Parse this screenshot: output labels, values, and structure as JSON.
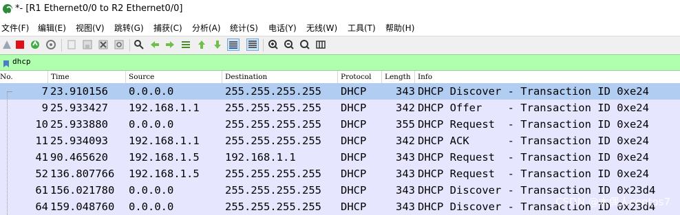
{
  "window": {
    "title": "*- [R1 Ethernet0/0 to R2 Ethernet0/0]"
  },
  "menu": [
    {
      "label": "文件(F)"
    },
    {
      "label": "编辑(E)"
    },
    {
      "label": "视图(V)"
    },
    {
      "label": "跳转(G)"
    },
    {
      "label": "捕获(C)"
    },
    {
      "label": "分析(A)"
    },
    {
      "label": "统计(S)"
    },
    {
      "label": "电话(Y)"
    },
    {
      "label": "无线(W)"
    },
    {
      "label": "工具(T)"
    },
    {
      "label": "帮助(H)"
    }
  ],
  "toolbar": {
    "icons": [
      "shark-fin-start-icon",
      "stop-icon",
      "restart-icon",
      "options-icon",
      "open-file-icon",
      "save-icon",
      "close-file-icon",
      "reload-icon",
      "find-icon",
      "go-back-icon",
      "go-forward-icon",
      "go-to-packet-icon",
      "first-packet-icon",
      "last-packet-icon",
      "autoscroll-icon",
      "colorize-icon",
      "zoom-in-icon",
      "zoom-out-icon",
      "normal-size-icon",
      "resize-columns-icon"
    ]
  },
  "filter": {
    "value": "dhcp"
  },
  "columns": [
    "No.",
    "Time",
    "Source",
    "Destination",
    "Protocol",
    "Length",
    "Info"
  ],
  "packets": [
    {
      "no": "7",
      "time": "23.910156",
      "src": "0.0.0.0",
      "dst": "255.255.255.255",
      "proto": "DHCP",
      "len": "343",
      "info": "DHCP Discover - Transaction ID 0xe24",
      "selected": true
    },
    {
      "no": "9",
      "time": "25.933427",
      "src": "192.168.1.1",
      "dst": "255.255.255.255",
      "proto": "DHCP",
      "len": "342",
      "info": "DHCP Offer    - Transaction ID 0xe24"
    },
    {
      "no": "10",
      "time": "25.933880",
      "src": "0.0.0.0",
      "dst": "255.255.255.255",
      "proto": "DHCP",
      "len": "355",
      "info": "DHCP Request  - Transaction ID 0xe24"
    },
    {
      "no": "11",
      "time": "25.934093",
      "src": "192.168.1.1",
      "dst": "255.255.255.255",
      "proto": "DHCP",
      "len": "342",
      "info": "DHCP ACK      - Transaction ID 0xe24"
    },
    {
      "no": "41",
      "time": "90.465620",
      "src": "192.168.1.5",
      "dst": "192.168.1.1",
      "proto": "DHCP",
      "len": "343",
      "info": "DHCP Request  - Transaction ID 0xe24"
    },
    {
      "no": "52",
      "time": "136.807766",
      "src": "192.168.1.5",
      "dst": "255.255.255.255",
      "proto": "DHCP",
      "len": "343",
      "info": "DHCP Request  - Transaction ID 0xe24"
    },
    {
      "no": "61",
      "time": "156.021780",
      "src": "0.0.0.0",
      "dst": "255.255.255.255",
      "proto": "DHCP",
      "len": "343",
      "info": "DHCP Discover - Transaction ID 0x23d4"
    },
    {
      "no": "64",
      "time": "159.048760",
      "src": "0.0.0.0",
      "dst": "255.255.255.255",
      "proto": "DHCP",
      "len": "343",
      "info": "DHCP Discover - Transaction ID 0x23d4"
    }
  ],
  "watermark": "CSDN @木偶人centos7",
  "colors": {
    "selected_row": "#b1cdf1",
    "row": "#e7e6ff",
    "filter_bg": "#afffaf",
    "toolbar_bg": "#f0f0f0"
  }
}
